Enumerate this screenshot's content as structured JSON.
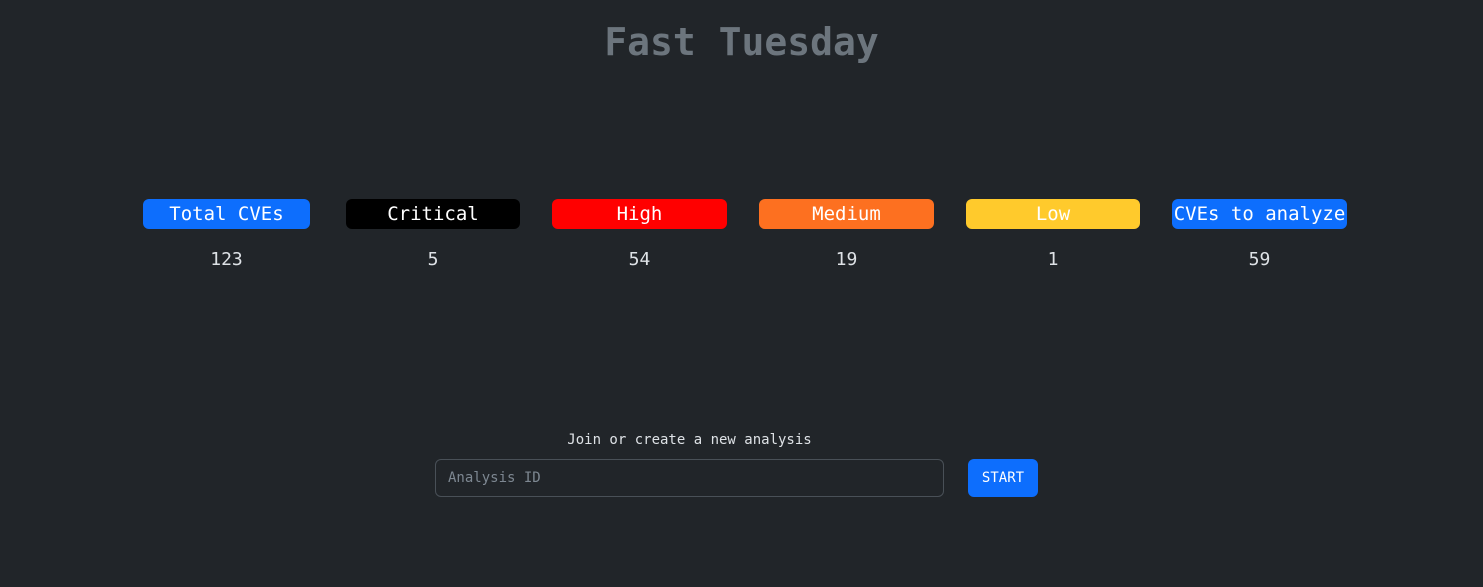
{
  "title": "Fast Tuesday",
  "stats": [
    {
      "label": "Total CVEs",
      "value": "123",
      "color": "#0d6efd"
    },
    {
      "label": "Critical",
      "value": "5",
      "color": "#000000"
    },
    {
      "label": "High",
      "value": "54",
      "color": "#ff0000"
    },
    {
      "label": "Medium",
      "value": "19",
      "color": "#fd7020"
    },
    {
      "label": "Low",
      "value": "1",
      "color": "#ffca2c"
    },
    {
      "label": "CVEs to analyze",
      "value": "59",
      "color": "#0d6efd"
    }
  ],
  "analysis_form": {
    "label": "Join or create a new analysis",
    "input_placeholder": "Analysis ID",
    "input_value": "",
    "button_label": "START"
  }
}
